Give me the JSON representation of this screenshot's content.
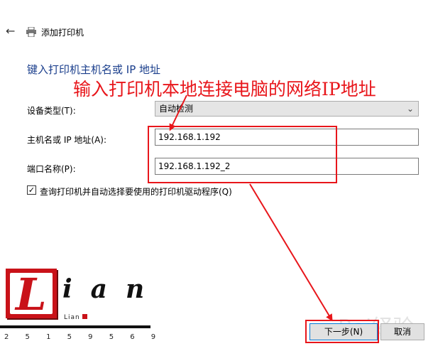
{
  "window": {
    "back_icon": "back-arrow-icon",
    "printer_icon": "printer-icon",
    "title": "添加打印机"
  },
  "heading": "键入打印机主机名或 IP 地址",
  "annotation": "输入打印机本地连接电脑的网络IP地址",
  "form": {
    "device_type_label": "设备类型(T):",
    "device_type_value": "自动检测",
    "hostname_label": "主机名或 IP 地址(A):",
    "hostname_value": "192.168.1.192",
    "port_label": "端口名称(P):",
    "port_value": "192.168.1.192_2",
    "query_checkbox_checked": true,
    "query_checkbox_label": "查询打印机并自动选择要使用的打印机驱动程序(Q)"
  },
  "logo": {
    "letter": "L",
    "text": "ian",
    "sub": "Lian",
    "digits": "2 5 1 5 9 5 6 9"
  },
  "buttons": {
    "next": "下一步(N)",
    "cancel": "取消"
  },
  "watermark": "Bai経验",
  "colors": {
    "heading": "#1a3e8c",
    "annotation": "#e8161b",
    "logo": "#c91219"
  }
}
